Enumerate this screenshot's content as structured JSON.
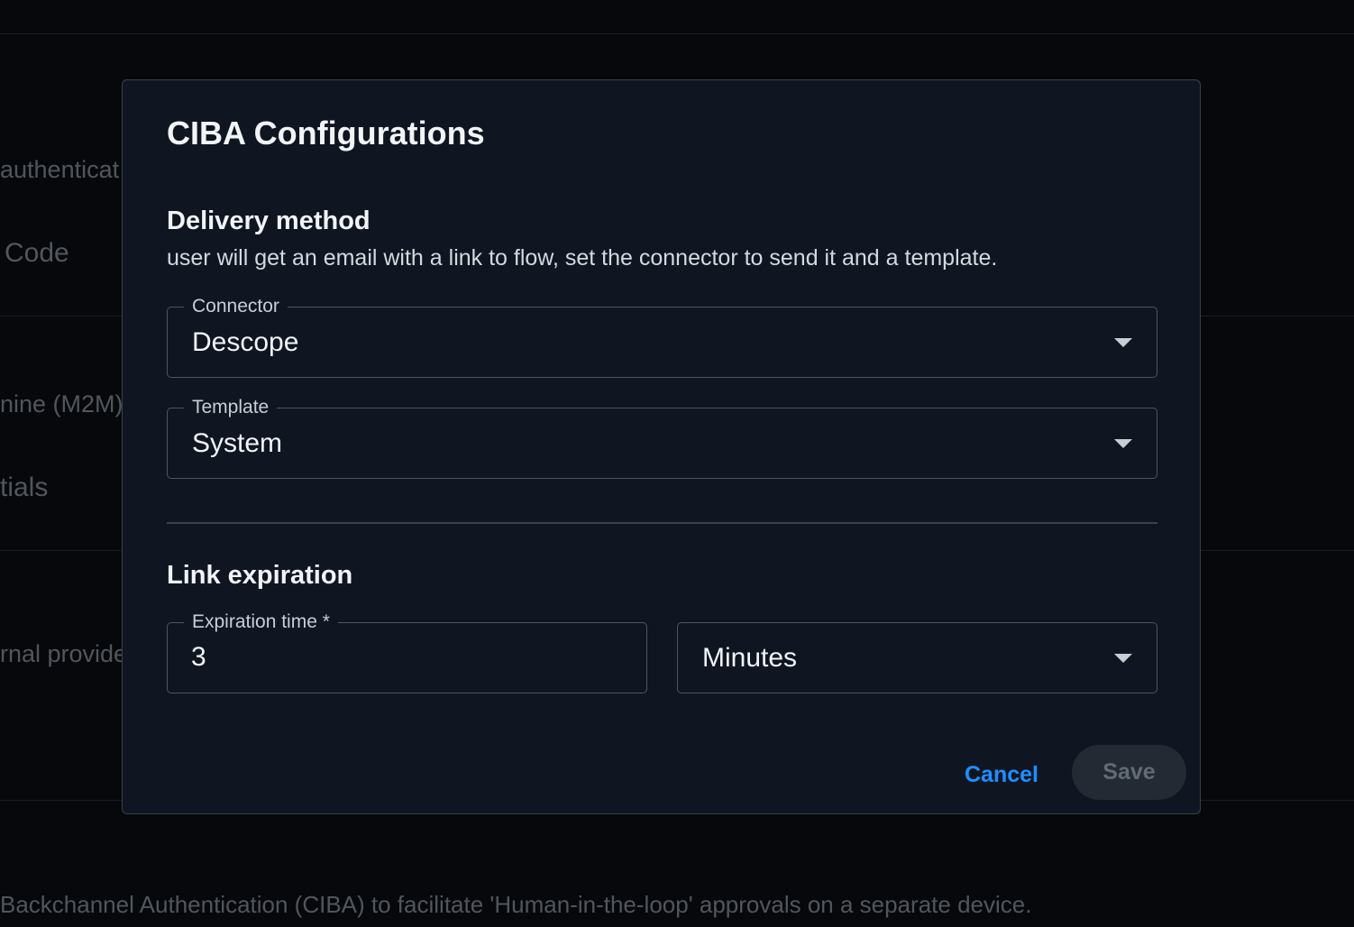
{
  "background": {
    "fragments": [
      "authenticat",
      "Code",
      "nine (M2M) b",
      "tials",
      "rnal provide",
      "Backchannel Authentication (CIBA) to facilitate 'Human-in-the-loop' approvals on a separate device."
    ]
  },
  "dialog": {
    "title": "CIBA Configurations",
    "delivery": {
      "heading": "Delivery method",
      "description": "user will get an email with a link to flow, set the connector to send it and a template.",
      "connector": {
        "label": "Connector",
        "value": "Descope"
      },
      "template": {
        "label": "Template",
        "value": "System"
      }
    },
    "expiration": {
      "heading": "Link expiration",
      "time": {
        "label": "Expiration time *",
        "value": "3"
      },
      "unit": {
        "value": "Minutes"
      }
    },
    "actions": {
      "cancel_label": "Cancel",
      "save_label": "Save",
      "save_disabled": true
    }
  },
  "colors": {
    "accent": "#1f8fff",
    "dialog_bg": "#0f1622",
    "page_bg": "#0a0d12",
    "field_border": "#4d5562",
    "save_disabled_bg": "#232a34"
  }
}
